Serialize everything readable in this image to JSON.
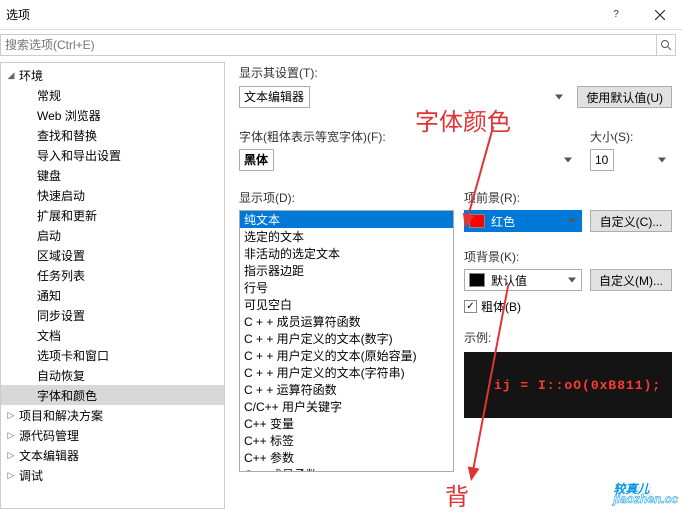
{
  "window": {
    "title": "选项"
  },
  "search": {
    "placeholder": "搜索选项(Ctrl+E)"
  },
  "tree": {
    "items": [
      {
        "label": "环境",
        "depth": 0,
        "expanded": true
      },
      {
        "label": "常规",
        "depth": 1
      },
      {
        "label": "Web 浏览器",
        "depth": 1
      },
      {
        "label": "查找和替换",
        "depth": 1
      },
      {
        "label": "导入和导出设置",
        "depth": 1
      },
      {
        "label": "键盘",
        "depth": 1
      },
      {
        "label": "快速启动",
        "depth": 1
      },
      {
        "label": "扩展和更新",
        "depth": 1
      },
      {
        "label": "启动",
        "depth": 1
      },
      {
        "label": "区域设置",
        "depth": 1
      },
      {
        "label": "任务列表",
        "depth": 1
      },
      {
        "label": "通知",
        "depth": 1
      },
      {
        "label": "同步设置",
        "depth": 1
      },
      {
        "label": "文档",
        "depth": 1
      },
      {
        "label": "选项卡和窗口",
        "depth": 1
      },
      {
        "label": "自动恢复",
        "depth": 1
      },
      {
        "label": "字体和颜色",
        "depth": 1,
        "selected": true
      },
      {
        "label": "项目和解决方案",
        "depth": 0,
        "collapsed": true
      },
      {
        "label": "源代码管理",
        "depth": 0,
        "collapsed": true
      },
      {
        "label": "文本编辑器",
        "depth": 0,
        "collapsed": true
      },
      {
        "label": "调试",
        "depth": 0,
        "collapsed": true
      }
    ]
  },
  "settings": {
    "show_settings_label": "显示其设置(T):",
    "show_settings_value": "文本编辑器",
    "use_defaults_btn": "使用默认值(U)",
    "font_label": "字体(粗体表示等宽字体)(F):",
    "font_value": "黑体",
    "size_label": "大小(S):",
    "size_value": "10",
    "display_items_label": "显示项(D):",
    "fg_label": "项前景(R):",
    "fg_value": "红色",
    "fg_color": "#ff0000",
    "fg_sel_bg": "#0078d7",
    "custom_fg_btn": "自定义(C)...",
    "bg_label": "项背景(K):",
    "bg_value": "默认值",
    "bg_color": "#000000",
    "custom_bg_btn": "自定义(M)...",
    "bold_label": "粗体(B)",
    "bold_checked": true,
    "sample_label": "示例:",
    "sample_text": "ij = I::oO(0xB811);"
  },
  "display_items": [
    {
      "label": "纯文本",
      "selected": true
    },
    {
      "label": "选定的文本"
    },
    {
      "label": "非活动的选定文本"
    },
    {
      "label": "指示器边距"
    },
    {
      "label": "行号"
    },
    {
      "label": "可见空白"
    },
    {
      "label": "C + + 成员运算符函数"
    },
    {
      "label": "C + + 用户定义的文本(数字)"
    },
    {
      "label": "C + + 用户定义的文本(原始容量)"
    },
    {
      "label": "C + + 用户定义的文本(字符串)"
    },
    {
      "label": "C + + 运算符函数"
    },
    {
      "label": "C/C++ 用户关键字"
    },
    {
      "label": "C++ 变量"
    },
    {
      "label": "C++ 标签"
    },
    {
      "label": "C++ 参数"
    },
    {
      "label": "C++ 成员函数"
    }
  ],
  "annotations": {
    "font_color": "字体颜色",
    "bg_partial": "背"
  },
  "watermark": {
    "main": "较真儿",
    "sub": "jiaozhen.cc"
  }
}
